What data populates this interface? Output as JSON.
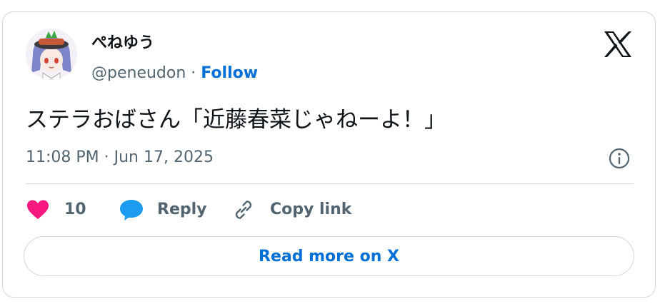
{
  "author": {
    "display_name": "ぺねゆう",
    "handle": "@peneudon",
    "separator": "·",
    "follow_label": "Follow"
  },
  "tweet": {
    "text": "ステラおばさん「近藤春菜じゃねーよ！」",
    "timestamp": "11:08 PM · Jun 17, 2025"
  },
  "actions": {
    "like_count": "10",
    "reply_label": "Reply",
    "copy_link_label": "Copy link"
  },
  "read_more_label": "Read more on X",
  "icons": {
    "logo": "x-logo-icon",
    "info": "info-icon",
    "like": "heart-icon",
    "reply": "speech-bubble-icon",
    "copy": "link-icon"
  },
  "colors": {
    "like": "#f91880",
    "reply": "#1d9bf0",
    "follow": "#006fd6",
    "muted": "#536471",
    "border": "#cfd9de"
  }
}
